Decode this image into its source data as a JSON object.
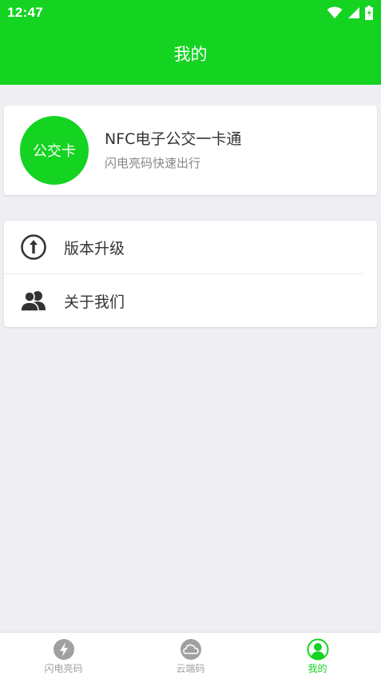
{
  "status_bar": {
    "time": "12:47"
  },
  "header": {
    "title": "我的"
  },
  "profile_card": {
    "avatar_text": "公交卡",
    "title": "NFC电子公交一卡通",
    "subtitle": "闪电亮码快速出行"
  },
  "menu": [
    {
      "label": "版本升级",
      "icon": "upgrade-icon"
    },
    {
      "label": "关于我们",
      "icon": "people-icon"
    }
  ],
  "bottom_nav": [
    {
      "label": "闪电亮码",
      "icon": "lightning-icon",
      "active": false
    },
    {
      "label": "云端码",
      "icon": "cloud-icon",
      "active": false
    },
    {
      "label": "我的",
      "icon": "user-icon",
      "active": true
    }
  ],
  "colors": {
    "accent": "#14d321",
    "background": "#eeeef3"
  }
}
